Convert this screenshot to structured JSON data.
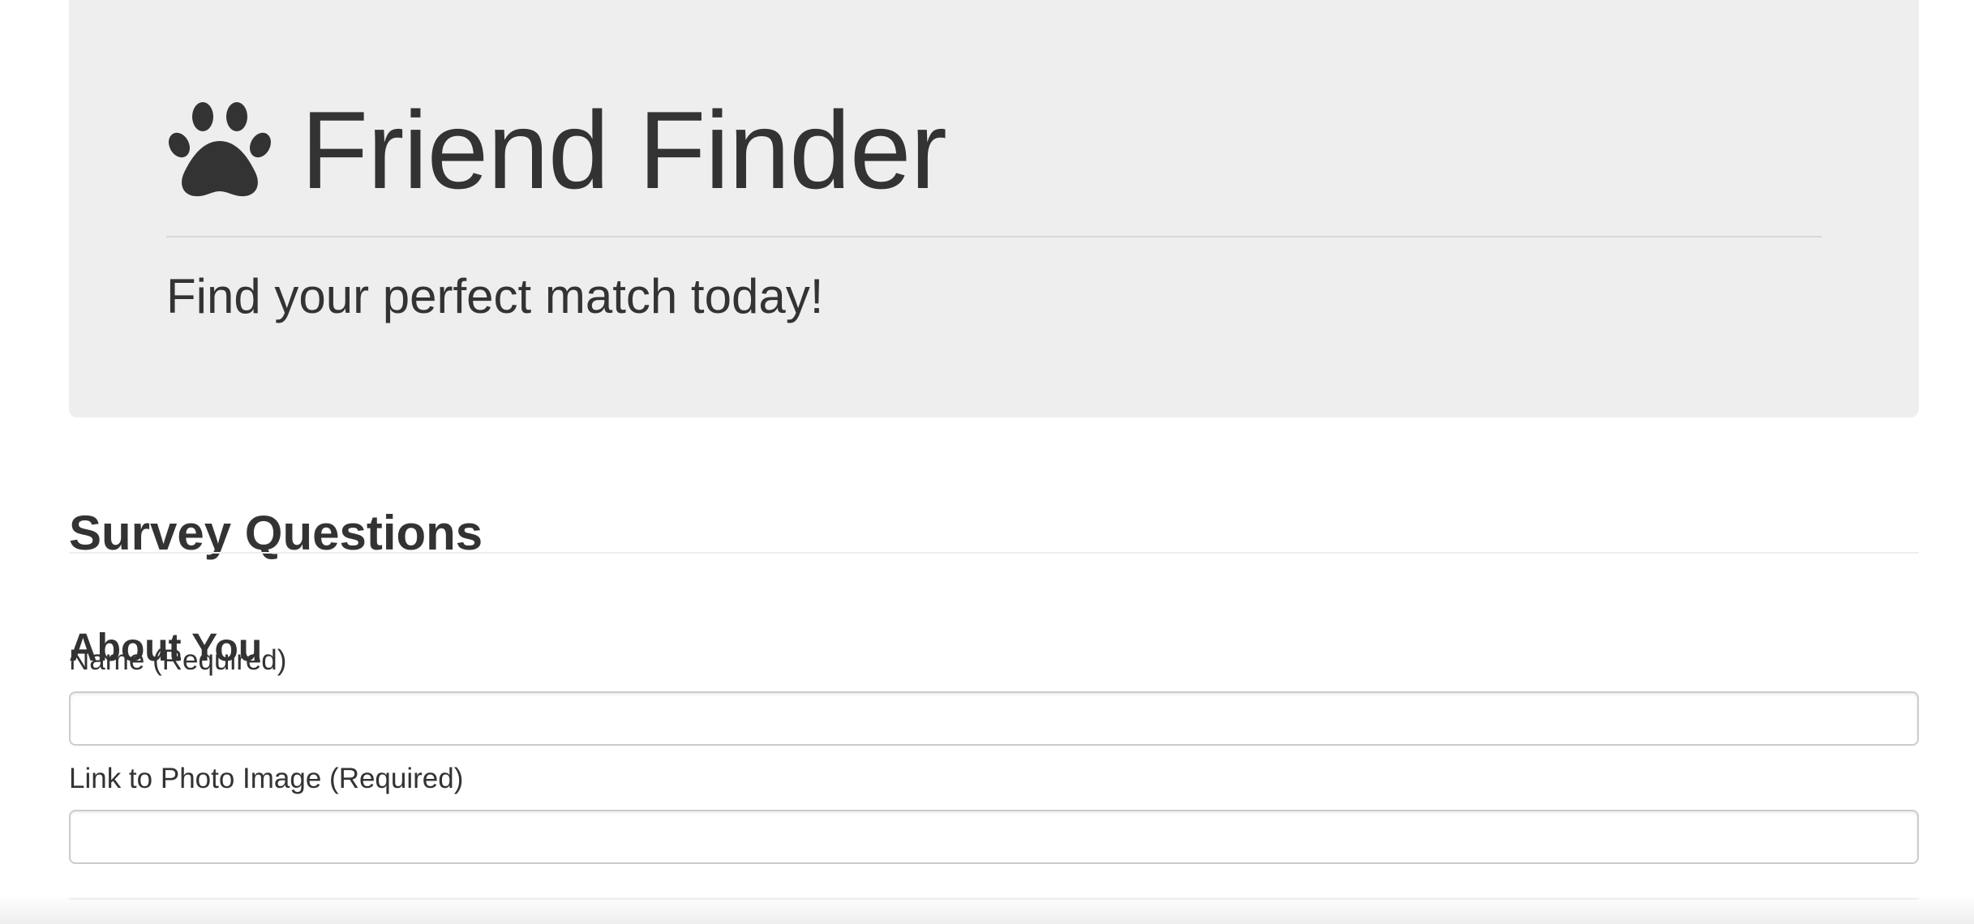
{
  "header": {
    "brand_icon": "paw-icon",
    "title": "Friend Finder",
    "subtitle": "Find your perfect match today!"
  },
  "survey": {
    "heading": "Survey Questions",
    "about_section": {
      "heading": "About You",
      "fields": [
        {
          "label": "Name (Required)",
          "value": "",
          "placeholder": ""
        },
        {
          "label": "Link to Photo Image (Required)",
          "value": "",
          "placeholder": ""
        }
      ]
    }
  },
  "colors": {
    "text": "#333333",
    "jumbotron_background": "#eeeeee",
    "input_border": "#cccccc",
    "page_background": "#ffffff"
  }
}
